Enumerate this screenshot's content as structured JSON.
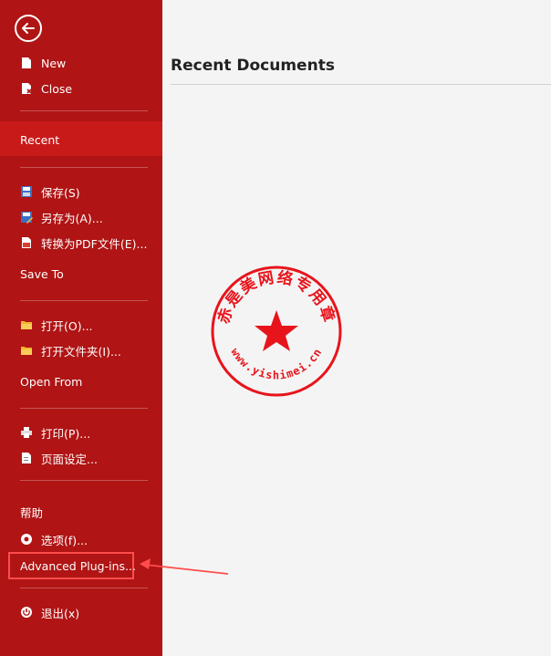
{
  "sidebar": {
    "top_items": [
      {
        "label": "New",
        "icon": "new-document-icon"
      },
      {
        "label": "Close",
        "icon": "close-document-icon"
      }
    ],
    "recent": "Recent",
    "save_items": [
      {
        "label": "保存(S)",
        "icon": "save-icon"
      },
      {
        "label": "另存为(A)...",
        "icon": "save-as-icon"
      },
      {
        "label": "转换为PDF文件(E)...",
        "icon": "pdf-icon"
      }
    ],
    "save_to": "Save To",
    "open_items": [
      {
        "label": "打开(O)...",
        "icon": "open-folder-icon"
      },
      {
        "label": "打开文件夹(I)...",
        "icon": "open-folder-icon"
      }
    ],
    "open_from": "Open From",
    "print_items": [
      {
        "label": "打印(P)...",
        "icon": "printer-icon"
      },
      {
        "label": "页面设定...",
        "icon": "page-setup-icon"
      }
    ],
    "help": "帮助",
    "options": {
      "label": "选项(f)...",
      "icon": "gear-icon"
    },
    "advanced": "Advanced Plug-ins...",
    "exit": {
      "label": "退出(x)",
      "icon": "power-icon"
    }
  },
  "main": {
    "title": "Recent Documents"
  },
  "watermark": {
    "top_text": "赤是美网络专用章",
    "bottom_text": "www.yishimei.cn",
    "color": "#e8141c"
  },
  "colors": {
    "sidebar_bg": "#b01414",
    "highlight": "#c91a1a",
    "annotation": "#ff4d4d"
  }
}
